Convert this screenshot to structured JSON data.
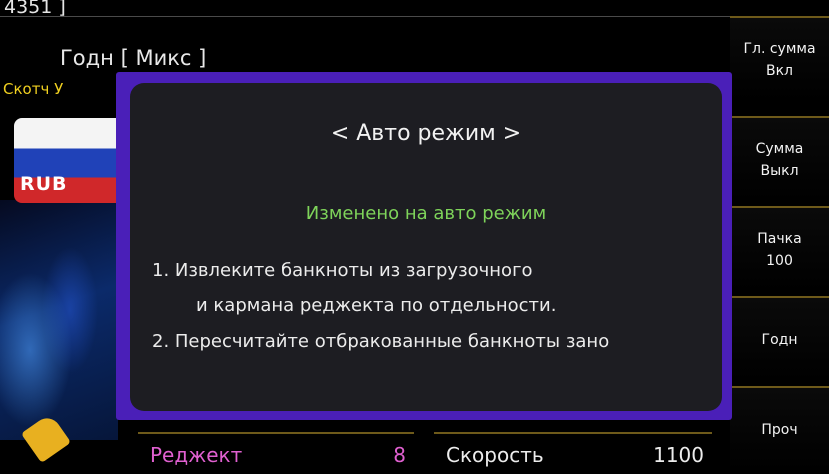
{
  "header": {
    "counter": "4351 ]",
    "mode_text": "Годн [ Микс ]",
    "scotch_text": "Скотч  У"
  },
  "currency": {
    "code": "RUB"
  },
  "sidebar": {
    "buttons": [
      {
        "line1": "Гл. сумма",
        "line2": "Вкл"
      },
      {
        "line1": "Сумма",
        "line2": "Выкл"
      },
      {
        "line1": "Пачка",
        "line2": "100"
      },
      {
        "line1": "Годн",
        "line2": ""
      },
      {
        "line1": "Проч",
        "line2": ""
      }
    ]
  },
  "dialog": {
    "title": "< Авто режим >",
    "status": "Изменено на авто режим",
    "lines": [
      "1. Извлеките банкноты из загрузочного",
      "и кармана реджекта по отдельности.",
      "2. Пересчитайте отбракованные банкноты зано"
    ]
  },
  "footer": {
    "reject_label": "Реджект",
    "reject_value": "8",
    "speed_label": "Скорость",
    "speed_value": "1100"
  },
  "colors": {
    "dialog_frame": "#4a1fb8",
    "status_green": "#7ed35a",
    "reject_pink": "#e060d0",
    "scotch_yellow": "#f0d020"
  }
}
